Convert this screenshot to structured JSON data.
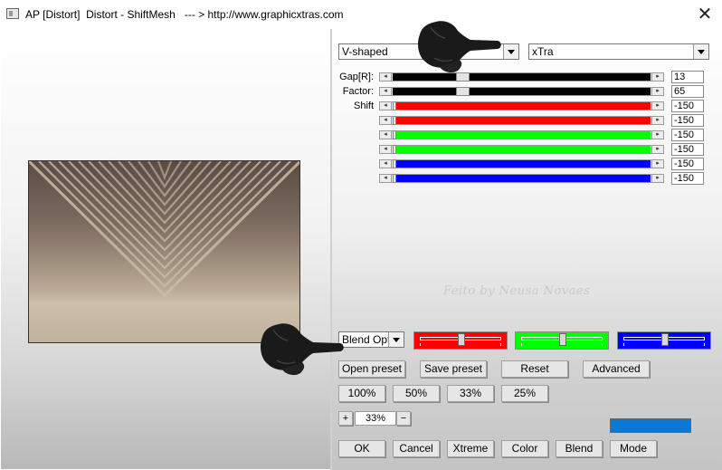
{
  "window": {
    "title": "AP [Distort]  Distort - ShiftMesh   --- > http://www.graphicxtras.com",
    "close_glyph": "✕"
  },
  "preview": {
    "bg_top": "#5a4a42",
    "bg_bottom": "#c8b8a4",
    "stripe_color": "#c9bca7"
  },
  "dropdowns": {
    "shape_value": "V-shaped",
    "mode_value": "xTra"
  },
  "params": {
    "gap_label": "Gap[R]:",
    "factor_label": "Factor:",
    "shift_label": "Shift",
    "gap_value": "13",
    "factor_value": "65",
    "shift_values": [
      "-150",
      "-150",
      "-150",
      "-150",
      "-150",
      "-150"
    ],
    "shift_colors": [
      "#ff0000",
      "#ff0000",
      "#00ff00",
      "#00ff00",
      "#0000ff",
      "#0000ff"
    ]
  },
  "watermark": "Feito by  Neusa Novaes",
  "blend": {
    "select_value": "Blend Optic",
    "red": "#ff0000",
    "green": "#00ff00",
    "blue": "#0000ff",
    "red_level": 0.5,
    "green_level": 0.5,
    "blue_level": 0.5
  },
  "buttons": {
    "open_preset": "Open preset",
    "save_preset": "Save preset",
    "reset": "Reset",
    "advanced": "Advanced",
    "zoom_100": "100%",
    "zoom_50": "50%",
    "zoom_33": "33%",
    "zoom_25": "25%",
    "ok": "OK",
    "cancel": "Cancel",
    "xtreme": "Xtreme",
    "color": "Color",
    "blend": "Blend",
    "mode": "Mode"
  },
  "zoom": {
    "plus": "+",
    "minus": "−",
    "value": "33%"
  },
  "color_swatch": "#0a78d7"
}
